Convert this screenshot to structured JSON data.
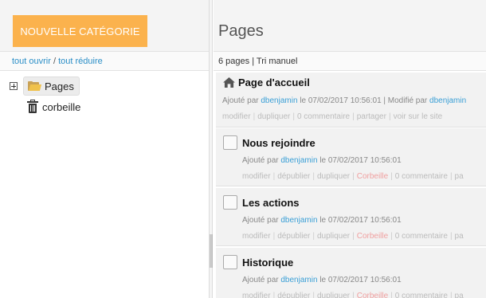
{
  "left": {
    "new_category_button": "NOUVELLE CATÉGORIE",
    "expand_all": "tout ouvrir",
    "link_sep": "/",
    "collapse_all": "tout réduire",
    "tree": {
      "pages_label": "Pages",
      "trash_label": "corbeille"
    }
  },
  "right": {
    "title": "Pages",
    "info": "6 pages | Tri manuel",
    "items": [
      {
        "title": "Page d'accueil",
        "added_by": "Ajouté par",
        "author": "dbenjamin",
        "date_text": "le 07/02/2017 10:56:01 | Modifié par",
        "author2": "dbenjamin",
        "actions": [
          "modifier",
          "dupliquer",
          "0 commentaire",
          "partager",
          "voir sur le site"
        ]
      },
      {
        "title": "Nous rejoindre",
        "added_by": "Ajouté par",
        "author": "dbenjamin",
        "date_text": "le 07/02/2017 10:56:01",
        "actions": [
          "modifier",
          "dépublier",
          "dupliquer",
          "Corbeille",
          "0 commentaire",
          "pa"
        ]
      },
      {
        "title": "Les actions",
        "added_by": "Ajouté par",
        "author": "dbenjamin",
        "date_text": "le 07/02/2017 10:56:01",
        "actions": [
          "modifier",
          "dépublier",
          "dupliquer",
          "Corbeille",
          "0 commentaire",
          "pa"
        ]
      },
      {
        "title": "Historique",
        "added_by": "Ajouté par",
        "author": "dbenjamin",
        "date_text": "le 07/02/2017 10:56:01",
        "actions": [
          "modifier",
          "dépublier",
          "dupliquer",
          "Corbeille",
          "0 commentaire",
          "pa"
        ]
      }
    ]
  },
  "colors": {
    "accent_button": "#fbb24d",
    "link": "#2a8ec7",
    "author_link": "#3a9fd6",
    "trash_action": "#f0a0a0"
  }
}
